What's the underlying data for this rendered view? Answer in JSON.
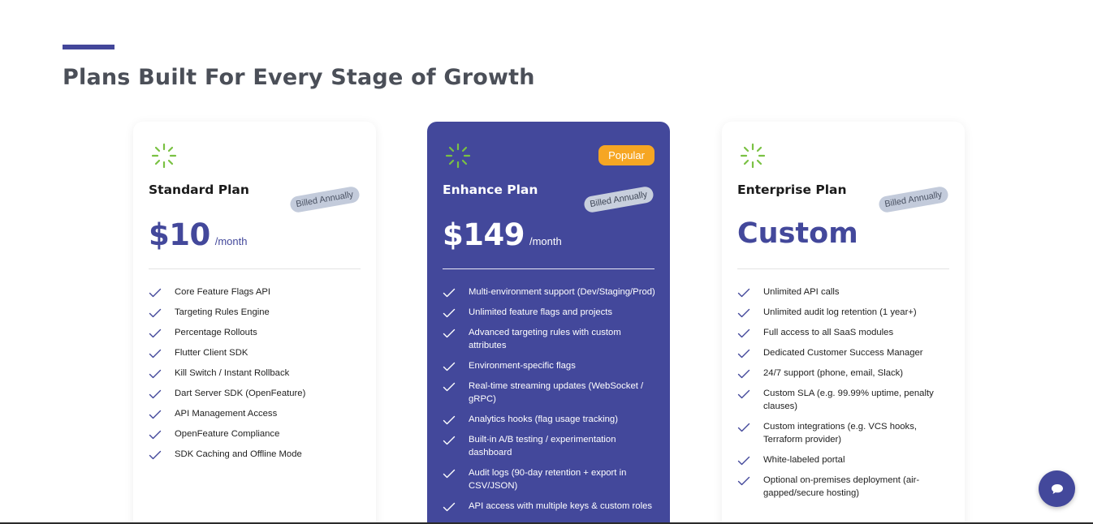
{
  "section": {
    "title": "Plans Built For Every Stage of Growth"
  },
  "colors": {
    "accent": "#43489b",
    "popular": "#f6a623",
    "loader": "#7ac143"
  },
  "plans": [
    {
      "name": "Standard Plan",
      "billed": "Billed Annually",
      "price": "$10",
      "per": "/month",
      "features": [
        "Core Feature Flags API",
        "Targeting Rules Engine",
        "Percentage Rollouts",
        "Flutter Client SDK",
        "Kill Switch / Instant Rollback",
        "Dart Server SDK (OpenFeature)",
        "API Management Access",
        "OpenFeature Compliance",
        "SDK Caching and Offline Mode"
      ]
    },
    {
      "name": "Enhance Plan",
      "badge": "Popular",
      "billed": "Billed Annually",
      "price": "$149",
      "per": "/month",
      "features": [
        "Multi-environment support (Dev/Staging/Prod)",
        "Unlimited feature flags and projects",
        "Advanced targeting rules with custom attributes",
        "Environment-specific flags",
        "Real-time streaming updates (WebSocket / gRPC)",
        "Analytics hooks (flag usage tracking)",
        "Built-in A/B testing / experimentation dashboard",
        "Audit logs (90-day retention + export in CSV/JSON)",
        "API access with multiple keys & custom roles"
      ]
    },
    {
      "name": "Enterprise Plan",
      "billed": "Billed Annually",
      "price": "Custom",
      "features": [
        "Unlimited API calls",
        "Unlimited audit log retention (1 year+)",
        "Full access to all SaaS modules",
        "Dedicated Customer Success Manager",
        "24/7 support (phone, email, Slack)",
        "Custom SLA (e.g. 99.99% uptime, penalty clauses)",
        "Custom integrations (e.g. VCS hooks, Terraform provider)",
        "White-labeled portal",
        "Optional on-premises deployment (air-gapped/secure hosting)"
      ]
    }
  ],
  "icons": {
    "loader": "loader-icon",
    "check": "check-icon",
    "chat": "chat-bubble-icon"
  }
}
